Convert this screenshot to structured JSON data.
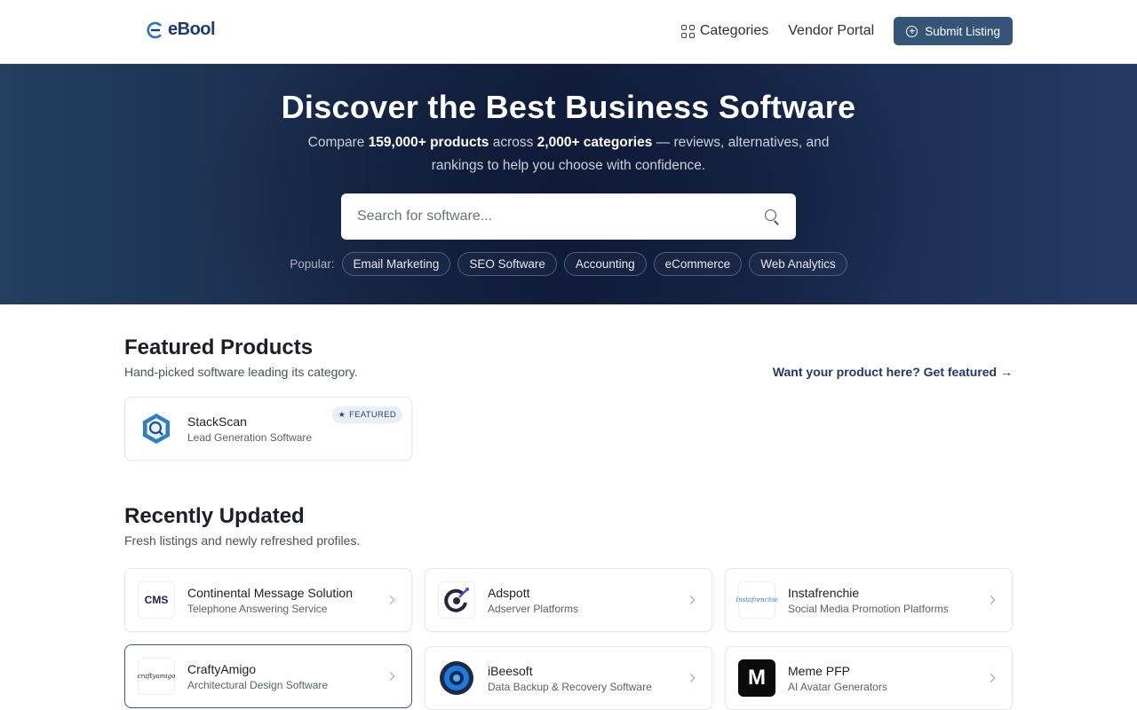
{
  "header": {
    "logo_text": "eBool",
    "nav": {
      "categories": "Categories",
      "vendor_portal": "Vendor Portal",
      "submit": "Submit Listing"
    }
  },
  "hero": {
    "title": "Discover the Best Business Software",
    "sub_pre": "Compare ",
    "sub_products": "159,000+ products",
    "sub_mid": " across ",
    "sub_categories": "2,000+ categories",
    "sub_post": " — reviews, alternatives, and rankings to help you choose with confidence.",
    "search_placeholder": "Search for software...",
    "popular_label": "Popular:",
    "popular": [
      "Email Marketing",
      "SEO Software",
      "Accounting",
      "eCommerce",
      "Web Analytics"
    ]
  },
  "featured": {
    "title": "Featured Products",
    "subtitle": "Hand-picked software leading its category.",
    "cta": "Want your product here? Get featured →",
    "items": [
      {
        "name": "StackScan",
        "category": "Lead Generation Software",
        "badge": "FEATURED"
      }
    ]
  },
  "recent": {
    "title": "Recently Updated",
    "subtitle": "Fresh listings and newly refreshed profiles.",
    "items": [
      {
        "name": "Continental Message Solution",
        "category": "Telephone Answering Service",
        "logo_text": "CMS"
      },
      {
        "name": "Adspott",
        "category": "Adserver Platforms",
        "logo_text": ""
      },
      {
        "name": "Instafrenchie",
        "category": "Social Media Promotion Platforms",
        "logo_text": "Instafrenchie"
      },
      {
        "name": "CraftyAmigo",
        "category": "Architectural Design Software",
        "logo_text": "craftyamigo"
      },
      {
        "name": "iBeesoft",
        "category": "Data Backup & Recovery Software",
        "logo_text": ""
      },
      {
        "name": "Meme PFP",
        "category": "AI Avatar Generators",
        "logo_text": "M"
      }
    ]
  },
  "colors": {
    "brand": "#1e3a78",
    "button": "#345478",
    "hero_dark": "#131f3c"
  }
}
